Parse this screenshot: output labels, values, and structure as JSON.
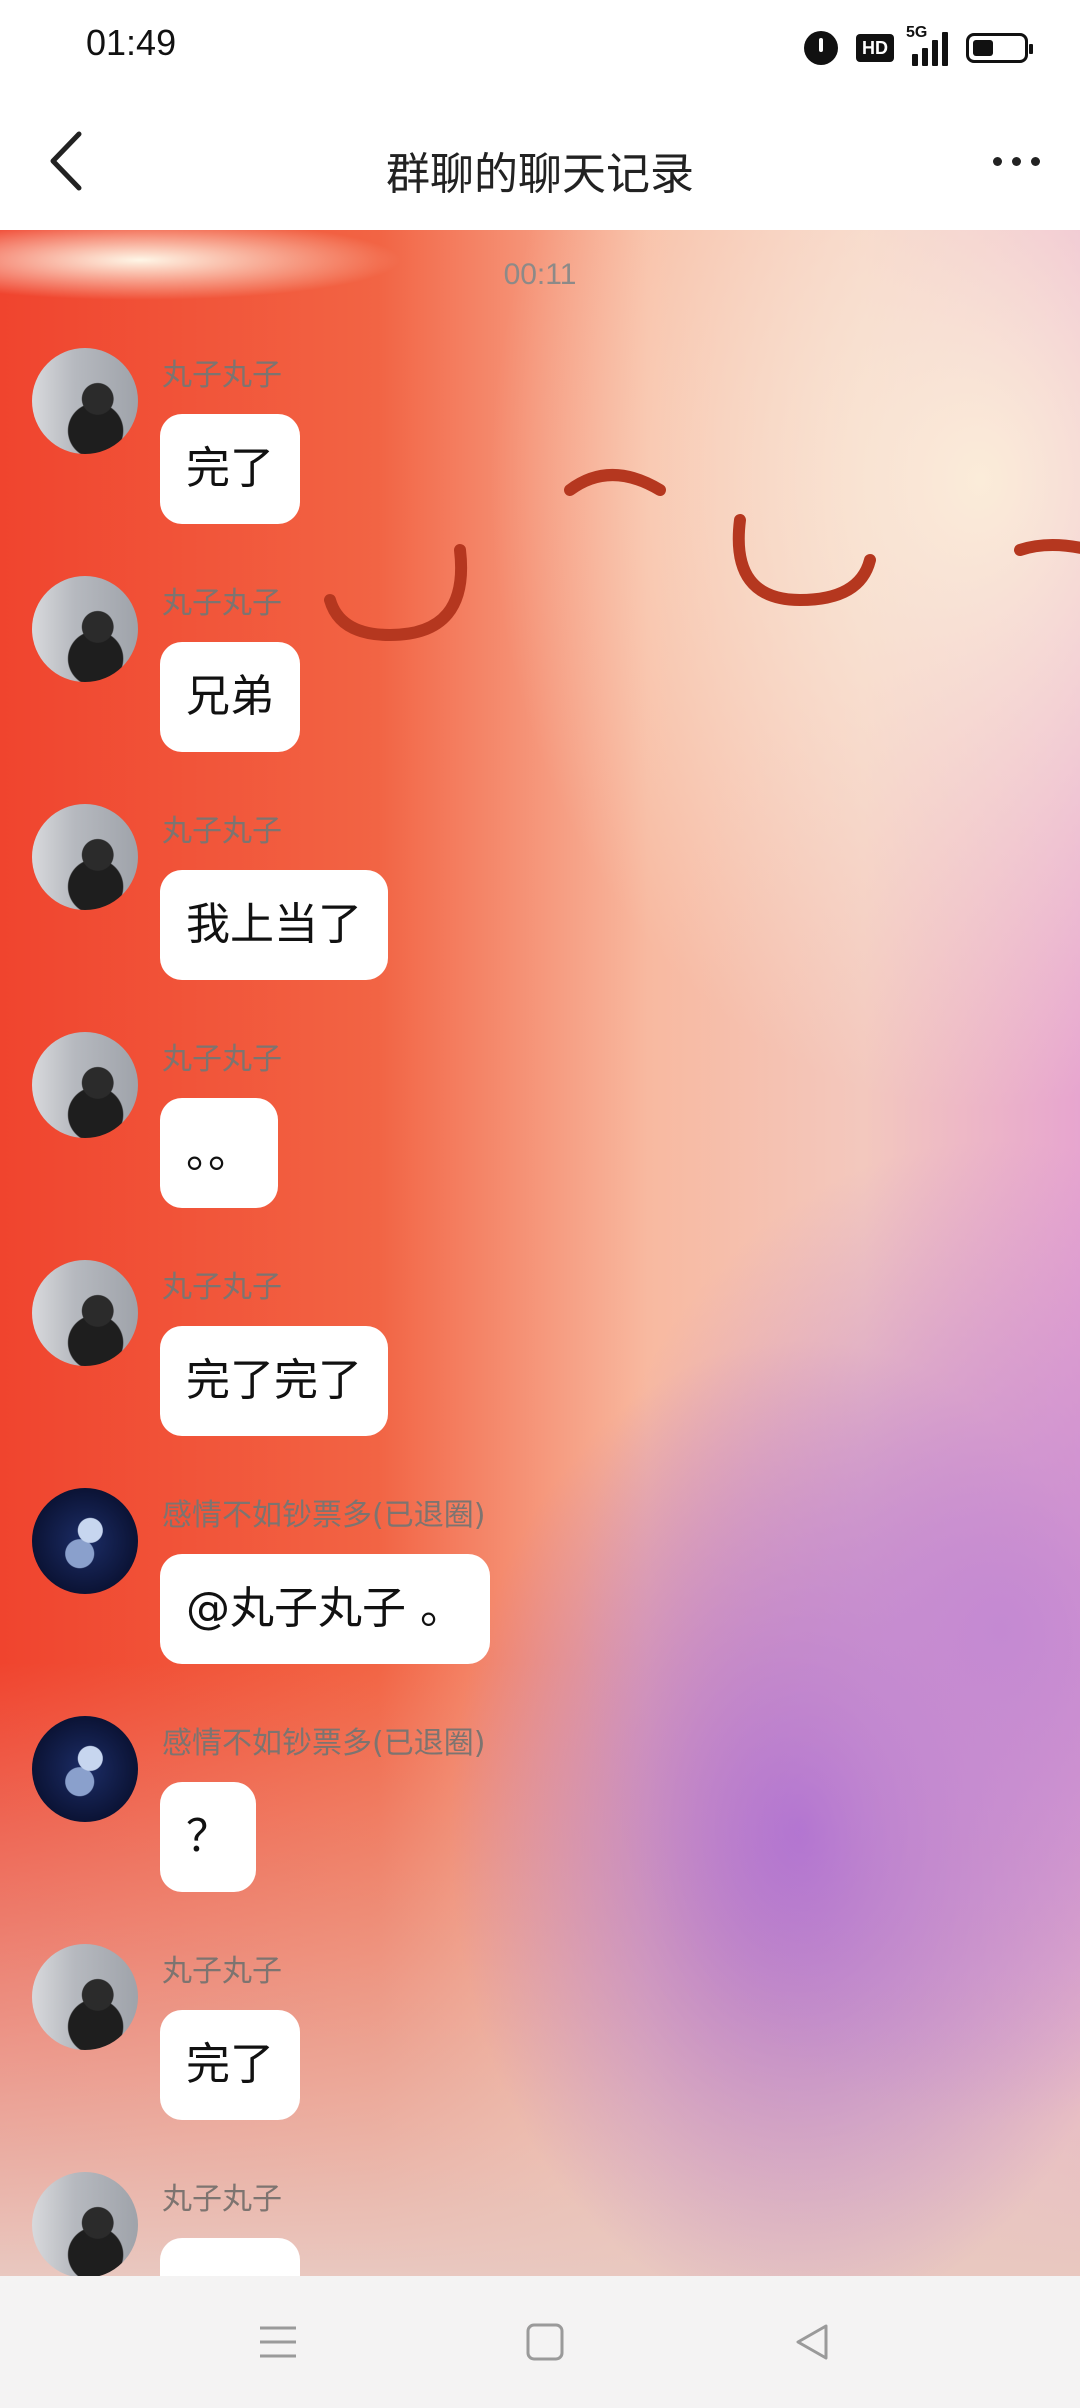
{
  "status_bar": {
    "time": "01:49",
    "hd_label": "HD",
    "network_label": "5G"
  },
  "header": {
    "title": "群聊的聊天记录"
  },
  "chat": {
    "timestamp": "00:11",
    "messages": [
      {
        "sender": "丸子丸子",
        "text": "完了"
      },
      {
        "sender": "丸子丸子",
        "text": "兄弟"
      },
      {
        "sender": "丸子丸子",
        "text": "我上当了"
      },
      {
        "sender": "丸子丸子",
        "text": "。。"
      },
      {
        "sender": "丸子丸子",
        "text": "完了完了"
      },
      {
        "sender": "感情不如钞票多(已退圈)",
        "text": "@丸子丸子 。"
      },
      {
        "sender": "感情不如钞票多(已退圈)",
        "text": "？"
      },
      {
        "sender": "丸子丸子",
        "text": "完了"
      },
      {
        "sender": "丸子丸子",
        "text": ""
      }
    ]
  },
  "icons": {
    "back": "chevron-left-icon",
    "more": "more-dots-icon",
    "alarm": "alarm-icon",
    "battery": "battery-icon",
    "nav_menu": "menu-icon",
    "nav_home": "home-square-icon",
    "nav_back": "back-triangle-icon"
  },
  "colors": {
    "bubble": "#ffffff",
    "sender_text": "#7d7470",
    "timestamp_text": "#8d8a88"
  }
}
